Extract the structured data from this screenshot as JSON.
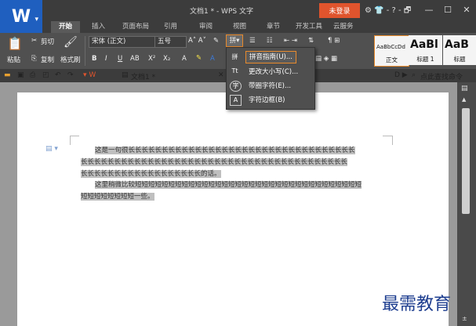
{
  "app": {
    "logo": "W",
    "title": "文档1 * - WPS 文字",
    "login": "未登录",
    "title_icons": "⚙ 👕 - ? - 🗗"
  },
  "tabs": [
    "开始",
    "插入",
    "页面布局",
    "引用",
    "审阅",
    "视图",
    "章节",
    "开发工具",
    "云服务"
  ],
  "ribbon": {
    "paste": "粘贴",
    "cut": "剪切",
    "copy": "复制",
    "format_painter": "格式刷",
    "font": "宋体 (正文)",
    "size": "五号",
    "styles": [
      {
        "sample": "AaBbCcDd",
        "label": "正文"
      },
      {
        "sample": "AaBl",
        "label": "标题 1"
      },
      {
        "sample": "AaB",
        "label": "标题"
      }
    ]
  },
  "doc_tab": "文档1 *",
  "search_placeholder": "点此查找命令",
  "menu": {
    "items": [
      {
        "label": "拼音指南(U)...",
        "icon": "拼",
        "selected": true
      },
      {
        "label": "更改大小写(C)...",
        "icon": "Tt",
        "selected": false
      },
      {
        "label": "带圈字符(E)...",
        "icon": "字",
        "selected": false
      },
      {
        "label": "字符边框(B)",
        "icon": "A",
        "selected": false
      }
    ]
  },
  "document": {
    "line1": "这是一句很长长长长长长长长长长长长长长长长长长长长长长长长长长长长长长长长长长",
    "line2": "长长长长长长长长长长长长长长长长长长长长长长长长长长长长长长长长长长长长长长长长",
    "line3": "长长长长长长长长长长长长长长长长长长的话。",
    "line4": "这里稍微比较短短短短短短短短短短短短短短短短短短短短短短短短短短短短短短短短短短",
    "line5": "短短短短短短短短一些。"
  },
  "watermark": "最需教育"
}
